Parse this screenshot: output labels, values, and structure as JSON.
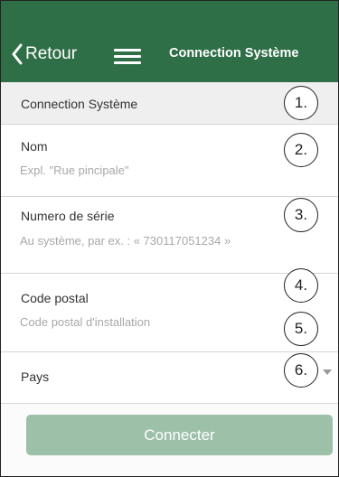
{
  "header": {
    "back_label": "Retour",
    "title": "Connection Système",
    "color": "#2f6f48"
  },
  "section": {
    "title": "Connection Système"
  },
  "fields": {
    "name": {
      "label": "Nom",
      "value": "",
      "placeholder": "Expl. \"Rue pincipale\""
    },
    "serial": {
      "label": "Numero de série",
      "value": "",
      "placeholder": "Au système, par ex. : « 730117051234 »"
    },
    "postal": {
      "label": "Code postal",
      "value": "",
      "placeholder": "Code postal d'installation"
    },
    "country": {
      "label": "Pays",
      "selected": ""
    }
  },
  "callouts": [
    "1.",
    "2.",
    "3.",
    "4.",
    "5.",
    "6."
  ],
  "button": {
    "label": "Connecter",
    "color": "#9cc0a8"
  },
  "icons": {
    "back": "chevron-left-icon",
    "menu": "hamburger-menu-icon",
    "dropdown": "caret-down-icon"
  }
}
